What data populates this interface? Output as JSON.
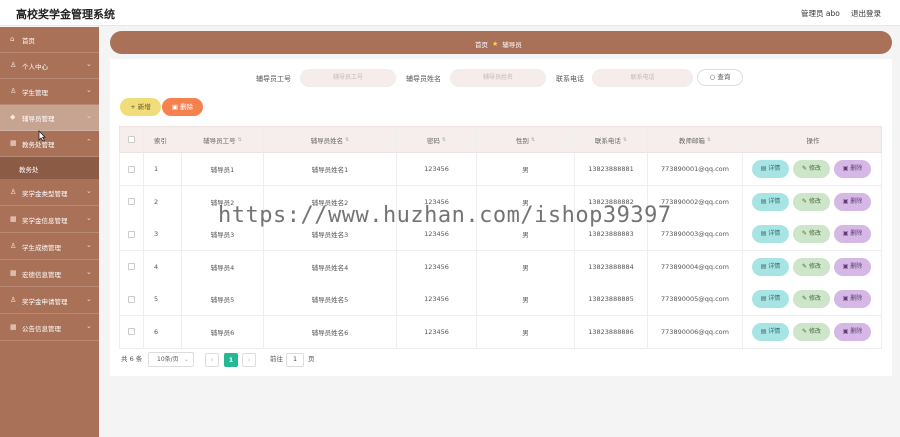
{
  "header": {
    "title": "高校奖学金管理系统",
    "user": "管理员 abo",
    "logout": "退出登录"
  },
  "sidebar": {
    "items": [
      {
        "label": "首页",
        "icon": "home-icon"
      },
      {
        "label": "个人中心",
        "icon": "user-icon"
      },
      {
        "label": "学生管理",
        "icon": "user-icon"
      },
      {
        "label": "辅导员管理",
        "icon": "shield-icon"
      },
      {
        "label": "教务处管理",
        "icon": "grid-icon"
      },
      {
        "label": "奖学金类型管理",
        "icon": "user-icon"
      },
      {
        "label": "奖学金信息管理",
        "icon": "grid-icon"
      },
      {
        "label": "学生成绩管理",
        "icon": "user-icon"
      },
      {
        "label": "宏德信息管理",
        "icon": "grid-icon"
      },
      {
        "label": "奖学金申请管理",
        "icon": "user-icon"
      },
      {
        "label": "公告信息管理",
        "icon": "grid-icon"
      }
    ],
    "sub_item": "教务处"
  },
  "breadcrumb": {
    "home": "首页",
    "current": "辅导员"
  },
  "filters": {
    "id_label": "辅导员工号",
    "id_placeholder": "辅导员工号",
    "name_label": "辅导员姓名",
    "name_placeholder": "辅导员姓名",
    "phone_label": "联系电话",
    "phone_placeholder": "联系电话",
    "query": "查询"
  },
  "actions": {
    "add": "新增",
    "delete": "删除"
  },
  "table": {
    "headers": [
      "索引",
      "辅导员工号",
      "辅导员姓名",
      "密码",
      "性别",
      "联系电话",
      "教师邮箱",
      "操作"
    ],
    "row_actions": {
      "detail": "详情",
      "edit": "修改",
      "remove": "删除"
    },
    "rows": [
      {
        "index": "1",
        "id": "辅导员1",
        "name": "辅导员姓名1",
        "password": "123456",
        "gender": "男",
        "phone": "13823888881",
        "email": "773890001@qq.com"
      },
      {
        "index": "2",
        "id": "辅导员2",
        "name": "辅导员姓名2",
        "password": "123456",
        "gender": "男",
        "phone": "13823888882",
        "email": "773890002@qq.com"
      },
      {
        "index": "3",
        "id": "辅导员3",
        "name": "辅导员姓名3",
        "password": "123456",
        "gender": "男",
        "phone": "13823888883",
        "email": "773890003@qq.com"
      },
      {
        "index": "4",
        "id": "辅导员4",
        "name": "辅导员姓名4",
        "password": "123456",
        "gender": "男",
        "phone": "13823888884",
        "email": "773890004@qq.com"
      },
      {
        "index": "5",
        "id": "辅导员5",
        "name": "辅导员姓名5",
        "password": "123456",
        "gender": "男",
        "phone": "13823888885",
        "email": "773890005@qq.com"
      },
      {
        "index": "6",
        "id": "辅导员6",
        "name": "辅导员姓名6",
        "password": "123456",
        "gender": "男",
        "phone": "13823888886",
        "email": "773890006@qq.com"
      }
    ]
  },
  "pagination": {
    "total": "共 6 条",
    "page_size": "10条/页",
    "current_page": "1",
    "goto_label": "前往",
    "goto_value": "1",
    "page_unit": "页"
  },
  "watermark": "https://www.huzhan.com/ishop39397",
  "colors": {
    "sidebar": "#a97158",
    "accent_green": "#26b893",
    "add": "#f0dd79",
    "delete": "#f5814f"
  }
}
